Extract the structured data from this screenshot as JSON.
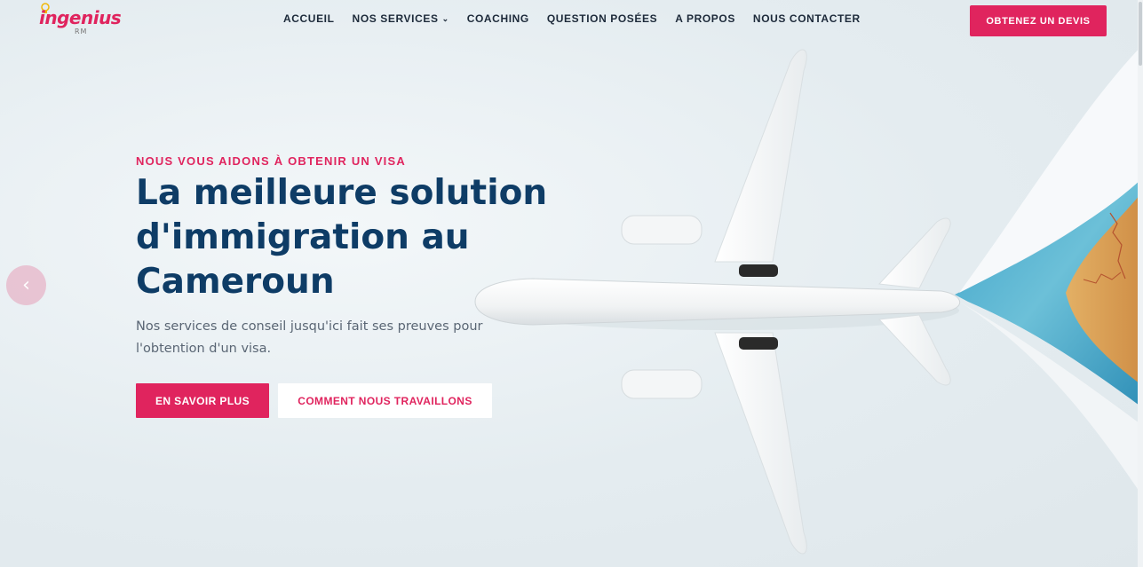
{
  "header": {
    "logo_text": "ingenius",
    "logo_sub": "RM",
    "nav": [
      {
        "label": "ACCUEIL"
      },
      {
        "label": "NOS SERVICES",
        "has_dropdown": true
      },
      {
        "label": "COACHING"
      },
      {
        "label": "QUESTION POSÉES"
      },
      {
        "label": "A PROPOS"
      },
      {
        "label": "NOUS CONTACTER"
      }
    ],
    "cta_label": "OBTENEZ UN DEVIS"
  },
  "hero": {
    "eyebrow": "NOUS VOUS AIDONS À OBTENIR UN VISA",
    "headline_lines": [
      "La meilleure solution",
      "d'immigration au",
      "Cameroun"
    ],
    "subtext_lines": [
      "Nos services de conseil jusqu'ici fait ses preuves pour",
      "l'obtention d'un visa."
    ],
    "primary_button": "EN SAVOIR PLUS",
    "secondary_button": "COMMENT NOUS TRAVAILLONS",
    "prev_arrow_icon": "chevron-left-icon"
  },
  "colors": {
    "accent": "#e0245e",
    "headline": "#0e3c66",
    "nav_text": "#1d2a3a",
    "body_text": "#5a6674"
  }
}
